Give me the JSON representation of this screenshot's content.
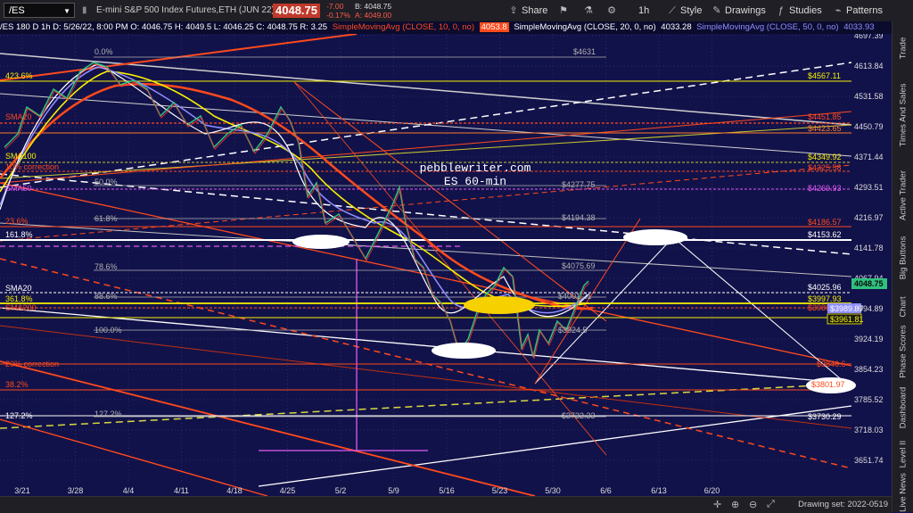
{
  "header": {
    "symbol": "/ES",
    "instrument": "E-mini S&P 500 Index Futures,ETH (JUN 22)",
    "last_price": "4048.75",
    "change": "-7.00",
    "change_pct": "-0.17%",
    "bid": "B: 4048.75",
    "ask": "A: 4049.00",
    "interval": "1h",
    "buttons": {
      "share": "Share",
      "style": "Style",
      "drawings": "Drawings",
      "studies": "Studies",
      "patterns": "Patterns"
    }
  },
  "study_bar": {
    "ohlc": "/ES 180 D 1h  D: 5/26/22, 8:00 PM  O: 4046.75  H: 4049.5  L: 4046.25  C: 4048.75  R: 3.25",
    "sma10": "SimpleMovingAvg (CLOSE, 10, 0, no)",
    "sma10_val": "4053.8",
    "sma20": "SimpleMovingAvg (CLOSE, 20, 0, no)",
    "sma20_val": "4033.28",
    "sma50": "SimpleMovingAvg (CLOSE, 50, 0, no)",
    "sma50_val": "4033.93"
  },
  "watermark": {
    "line1": "pebblewriter.com",
    "line2": "ES 60-min"
  },
  "price_axis": [
    "4697.39",
    "4613.84",
    "4531.58",
    "4450.79",
    "4371.44",
    "4293.51",
    "4216.97",
    "4141.78",
    "4067.94",
    "3994.89",
    "3924.19",
    "3854.23",
    "3785.52",
    "3718.03",
    "3651.74"
  ],
  "current_price_tag": "4048.75",
  "date_axis": [
    "3/21",
    "3/28",
    "4/4",
    "4/11",
    "4/18",
    "4/25",
    "5/2",
    "5/9",
    "5/16",
    "5/23",
    "5/30",
    "6/6",
    "6/13",
    "6/20"
  ],
  "levels": [
    {
      "label": "$4631",
      "color": "#b9b9b9"
    },
    {
      "label": "$4567.11",
      "color": "#f7f000"
    },
    {
      "label": "$4451.85",
      "color": "#ff4a1c"
    },
    {
      "label": "$4423.65",
      "color": "#ff7a2a"
    },
    {
      "label": "$4349.92",
      "color": "#f7f000"
    },
    {
      "label": "$4325.58",
      "color": "#ff4a1c"
    },
    {
      "label": "$4277.75",
      "color": "#b9b9b9"
    },
    {
      "label": "$4269.93",
      "color": "#e05af0"
    },
    {
      "label": "$4194.38",
      "color": "#b9b9b9"
    },
    {
      "label": "$4186.57",
      "color": "#ff4a1c"
    },
    {
      "label": "$4153.62",
      "color": "#ffffff"
    },
    {
      "label": "$4075.69",
      "color": "#b9b9b9"
    },
    {
      "label": "$4025.96",
      "color": "#ffffff"
    },
    {
      "label": "$4001.21",
      "color": "#b9b9b9"
    },
    {
      "label": "$3997.93",
      "color": "#f7f000"
    },
    {
      "label": "$3980.3",
      "color": "#ff4a1c"
    },
    {
      "label": "$3989.07",
      "color": "#8f8fff"
    },
    {
      "label": "$3961.81",
      "color": "#f7f000"
    },
    {
      "label": "$3846.6",
      "color": "#ff4a1c"
    },
    {
      "label": "$3801.97",
      "color": "#ff4a1c"
    },
    {
      "label": "$3730.29",
      "color": "#ffffff"
    },
    {
      "label": "$3732.33",
      "color": "#b9b9b9"
    },
    {
      "label": "$3924.5",
      "color": "#b9b9b9"
    }
  ],
  "fib_labels": [
    "0.0%",
    "23.6%",
    "50.0%",
    "61.8%",
    "78.6%",
    "88.6%",
    "100.0%",
    "127.2%"
  ],
  "left_labels": [
    "423.6%",
    "SMA20",
    "SMA100",
    "10% correction",
    "SMA50",
    "23.6%",
    "161.8%",
    "SMA20",
    "361.8%",
    "SMA200",
    "20% correction",
    "38.2%",
    "127.2%"
  ],
  "side_tabs": [
    "Trade",
    "Times And Sales",
    "Active Trader",
    "Big Buttons",
    "Chart",
    "Phase Scores",
    "Dashboard",
    "Level II",
    "Live News"
  ],
  "drawing_set": "Drawing set: 2022-0519"
}
